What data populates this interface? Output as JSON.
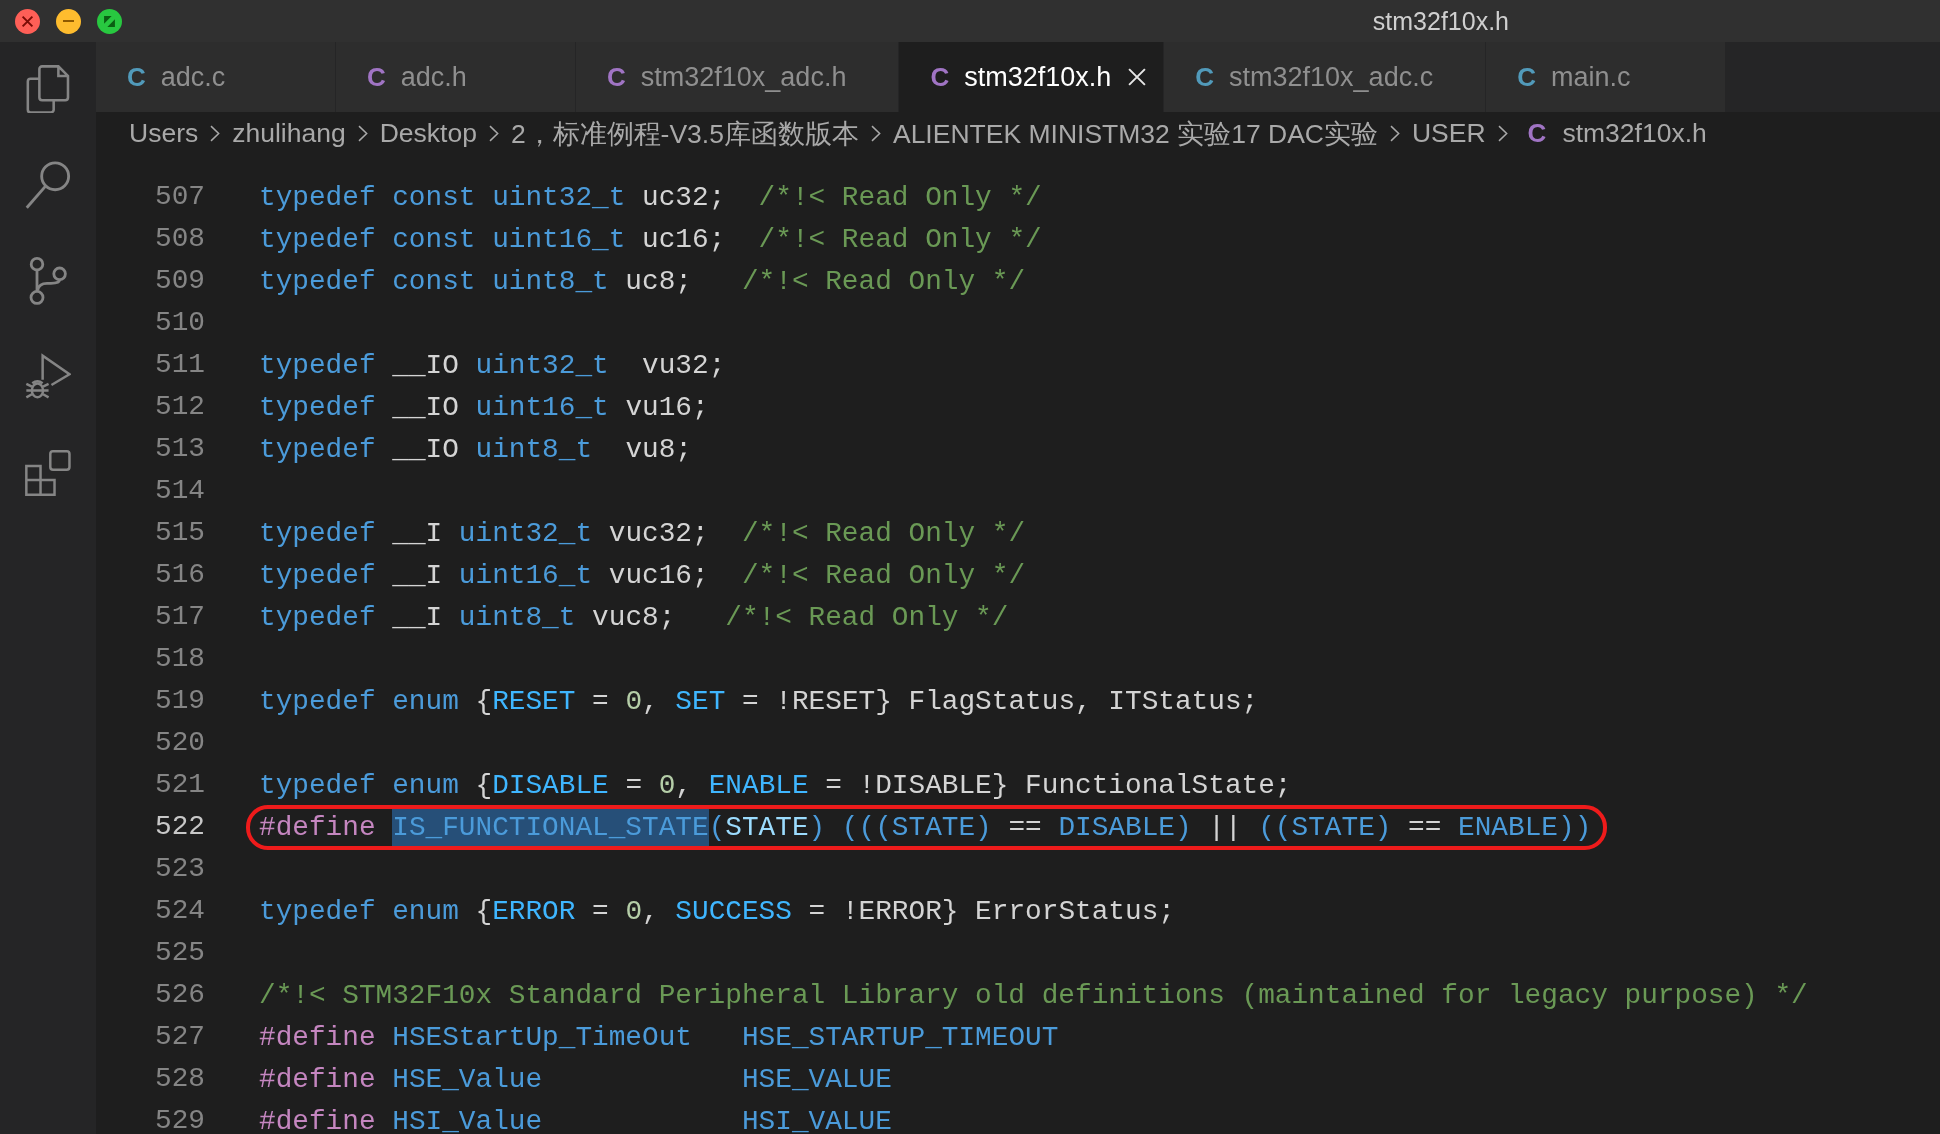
{
  "window": {
    "title": "stm32f10x.h"
  },
  "tabs": [
    {
      "icon": "C",
      "color": "#519aba",
      "label": "adc.c",
      "selected": false
    },
    {
      "icon": "C",
      "color": "#a074c4",
      "label": "adc.h",
      "selected": false
    },
    {
      "icon": "C",
      "color": "#a074c4",
      "label": "stm32f10x_adc.h",
      "selected": false
    },
    {
      "icon": "C",
      "color": "#a074c4",
      "label": "stm32f10x.h",
      "selected": true
    },
    {
      "icon": "C",
      "color": "#519aba",
      "label": "stm32f10x_adc.c",
      "selected": false
    },
    {
      "icon": "C",
      "color": "#519aba",
      "label": "main.c",
      "selected": false
    }
  ],
  "breadcrumb": {
    "items": [
      {
        "label": "Users"
      },
      {
        "label": "zhulihang"
      },
      {
        "label": "Desktop"
      },
      {
        "label": "2，标准例程-V3.5库函数版本"
      },
      {
        "label": "ALIENTEK MINISTM32 实验17 DAC实验"
      },
      {
        "label": "USER"
      },
      {
        "icon": "C",
        "color": "#a074c4",
        "label": "stm32f10x.h"
      }
    ]
  },
  "editor": {
    "lines": [
      {
        "number": "507",
        "current": false,
        "circled": false,
        "tokens": [
          {
            "kind": "keyword",
            "text": "typedef const uint32_t"
          },
          {
            "kind": "plain",
            "text": " uc32;  "
          },
          {
            "kind": "comment",
            "text": "/*!< Read Only */"
          }
        ]
      },
      {
        "number": "508",
        "current": false,
        "circled": false,
        "tokens": [
          {
            "kind": "keyword",
            "text": "typedef const uint16_t"
          },
          {
            "kind": "plain",
            "text": " uc16;  "
          },
          {
            "kind": "comment",
            "text": "/*!< Read Only */"
          }
        ]
      },
      {
        "number": "509",
        "current": false,
        "circled": false,
        "tokens": [
          {
            "kind": "keyword",
            "text": "typedef const uint8_t"
          },
          {
            "kind": "plain",
            "text": " uc8;   "
          },
          {
            "kind": "comment",
            "text": "/*!< Read Only */"
          }
        ]
      },
      {
        "number": "510",
        "current": false,
        "circled": false
      },
      {
        "number": "511",
        "current": false,
        "circled": false,
        "tokens": [
          {
            "kind": "keyword",
            "text": "typedef"
          },
          {
            "kind": "plain",
            "text": " __IO "
          },
          {
            "kind": "keyword",
            "text": "uint32_t"
          },
          {
            "kind": "plain",
            "text": "  vu32;"
          }
        ]
      },
      {
        "number": "512",
        "current": false,
        "circled": false,
        "tokens": [
          {
            "kind": "keyword",
            "text": "typedef"
          },
          {
            "kind": "plain",
            "text": " __IO "
          },
          {
            "kind": "keyword",
            "text": "uint16_t"
          },
          {
            "kind": "plain",
            "text": " vu16;"
          }
        ]
      },
      {
        "number": "513",
        "current": false,
        "circled": false,
        "tokens": [
          {
            "kind": "keyword",
            "text": "typedef"
          },
          {
            "kind": "plain",
            "text": " __IO "
          },
          {
            "kind": "keyword",
            "text": "uint8_t"
          },
          {
            "kind": "plain",
            "text": "  vu8;"
          }
        ]
      },
      {
        "number": "514",
        "current": false,
        "circled": false
      },
      {
        "number": "515",
        "current": false,
        "circled": false,
        "tokens": [
          {
            "kind": "keyword",
            "text": "typedef"
          },
          {
            "kind": "plain",
            "text": " __I "
          },
          {
            "kind": "keyword",
            "text": "uint32_t"
          },
          {
            "kind": "plain",
            "text": " vuc32;  "
          },
          {
            "kind": "comment",
            "text": "/*!< Read Only */"
          }
        ]
      },
      {
        "number": "516",
        "current": false,
        "circled": false,
        "tokens": [
          {
            "kind": "keyword",
            "text": "typedef"
          },
          {
            "kind": "plain",
            "text": " __I "
          },
          {
            "kind": "keyword",
            "text": "uint16_t"
          },
          {
            "kind": "plain",
            "text": " vuc16;  "
          },
          {
            "kind": "comment",
            "text": "/*!< Read Only */"
          }
        ]
      },
      {
        "number": "517",
        "current": false,
        "circled": false,
        "tokens": [
          {
            "kind": "keyword",
            "text": "typedef"
          },
          {
            "kind": "plain",
            "text": " __I "
          },
          {
            "kind": "keyword",
            "text": "uint8_t"
          },
          {
            "kind": "plain",
            "text": " vuc8;   "
          },
          {
            "kind": "comment",
            "text": "/*!< Read Only */"
          }
        ]
      },
      {
        "number": "518",
        "current": false,
        "circled": false
      },
      {
        "number": "519",
        "current": false,
        "circled": false,
        "tokens": [
          {
            "kind": "keyword",
            "text": "typedef enum"
          },
          {
            "kind": "plain",
            "text": " {"
          },
          {
            "kind": "constant",
            "text": "RESET"
          },
          {
            "kind": "plain",
            "text": " = "
          },
          {
            "kind": "number",
            "text": "0"
          },
          {
            "kind": "plain",
            "text": ", "
          },
          {
            "kind": "constant",
            "text": "SET"
          },
          {
            "kind": "plain",
            "text": " = !RESET} FlagStatus, ITStatus;"
          }
        ]
      },
      {
        "number": "520",
        "current": false,
        "circled": false
      },
      {
        "number": "521",
        "current": false,
        "circled": false,
        "tokens": [
          {
            "kind": "keyword",
            "text": "typedef enum"
          },
          {
            "kind": "plain",
            "text": " {"
          },
          {
            "kind": "constant",
            "text": "DISABLE"
          },
          {
            "kind": "plain",
            "text": " = "
          },
          {
            "kind": "number",
            "text": "0"
          },
          {
            "kind": "plain",
            "text": ", "
          },
          {
            "kind": "constant",
            "text": "ENABLE"
          },
          {
            "kind": "plain",
            "text": " = !DISABLE} FunctionalState;"
          }
        ]
      },
      {
        "number": "522",
        "current": true,
        "circled": true,
        "tokens": [
          {
            "kind": "directive",
            "text": "#define "
          },
          {
            "kind": "selection",
            "text": "IS_FUNCTIONAL_STATE"
          },
          {
            "kind": "macro",
            "text": "("
          },
          {
            "kind": "param",
            "text": "STATE"
          },
          {
            "kind": "macro",
            "text": ") (((STATE) "
          },
          {
            "kind": "plain",
            "text": "== "
          },
          {
            "kind": "macro",
            "text": "DISABLE) "
          },
          {
            "kind": "plain",
            "text": "|| "
          },
          {
            "kind": "macro",
            "text": "((STATE) "
          },
          {
            "kind": "plain",
            "text": "== "
          },
          {
            "kind": "macro",
            "text": "ENABLE))"
          }
        ]
      },
      {
        "number": "523",
        "current": false,
        "circled": false
      },
      {
        "number": "524",
        "current": false,
        "circled": false,
        "tokens": [
          {
            "kind": "keyword",
            "text": "typedef enum"
          },
          {
            "kind": "plain",
            "text": " {"
          },
          {
            "kind": "constant",
            "text": "ERROR"
          },
          {
            "kind": "plain",
            "text": " = "
          },
          {
            "kind": "number",
            "text": "0"
          },
          {
            "kind": "plain",
            "text": ", "
          },
          {
            "kind": "constant",
            "text": "SUCCESS"
          },
          {
            "kind": "plain",
            "text": " = !ERROR} ErrorStatus;"
          }
        ]
      },
      {
        "number": "525",
        "current": false,
        "circled": false
      },
      {
        "number": "526",
        "current": false,
        "circled": false,
        "tokens": [
          {
            "kind": "comment",
            "text": "/*!< STM32F10x Standard Peripheral Library old definitions (maintained for legacy purpose) */"
          }
        ]
      },
      {
        "number": "527",
        "current": false,
        "circled": false,
        "tokens": [
          {
            "kind": "directive",
            "text": "#define "
          },
          {
            "kind": "macro",
            "text": "HSEStartUp_TimeOut   "
          },
          {
            "kind": "macro",
            "text": "HSE_STARTUP_TIMEOUT"
          }
        ]
      },
      {
        "number": "528",
        "current": false,
        "circled": false,
        "tokens": [
          {
            "kind": "directive",
            "text": "#define "
          },
          {
            "kind": "macro",
            "text": "HSE_Value            "
          },
          {
            "kind": "macro",
            "text": "HSE_VALUE"
          }
        ]
      },
      {
        "number": "529",
        "current": false,
        "circled": false,
        "tokens": [
          {
            "kind": "directive",
            "text": "#define "
          },
          {
            "kind": "macro",
            "text": "HSI_Value            "
          },
          {
            "kind": "macro",
            "text": "HSI_VALUE"
          }
        ]
      }
    ]
  }
}
